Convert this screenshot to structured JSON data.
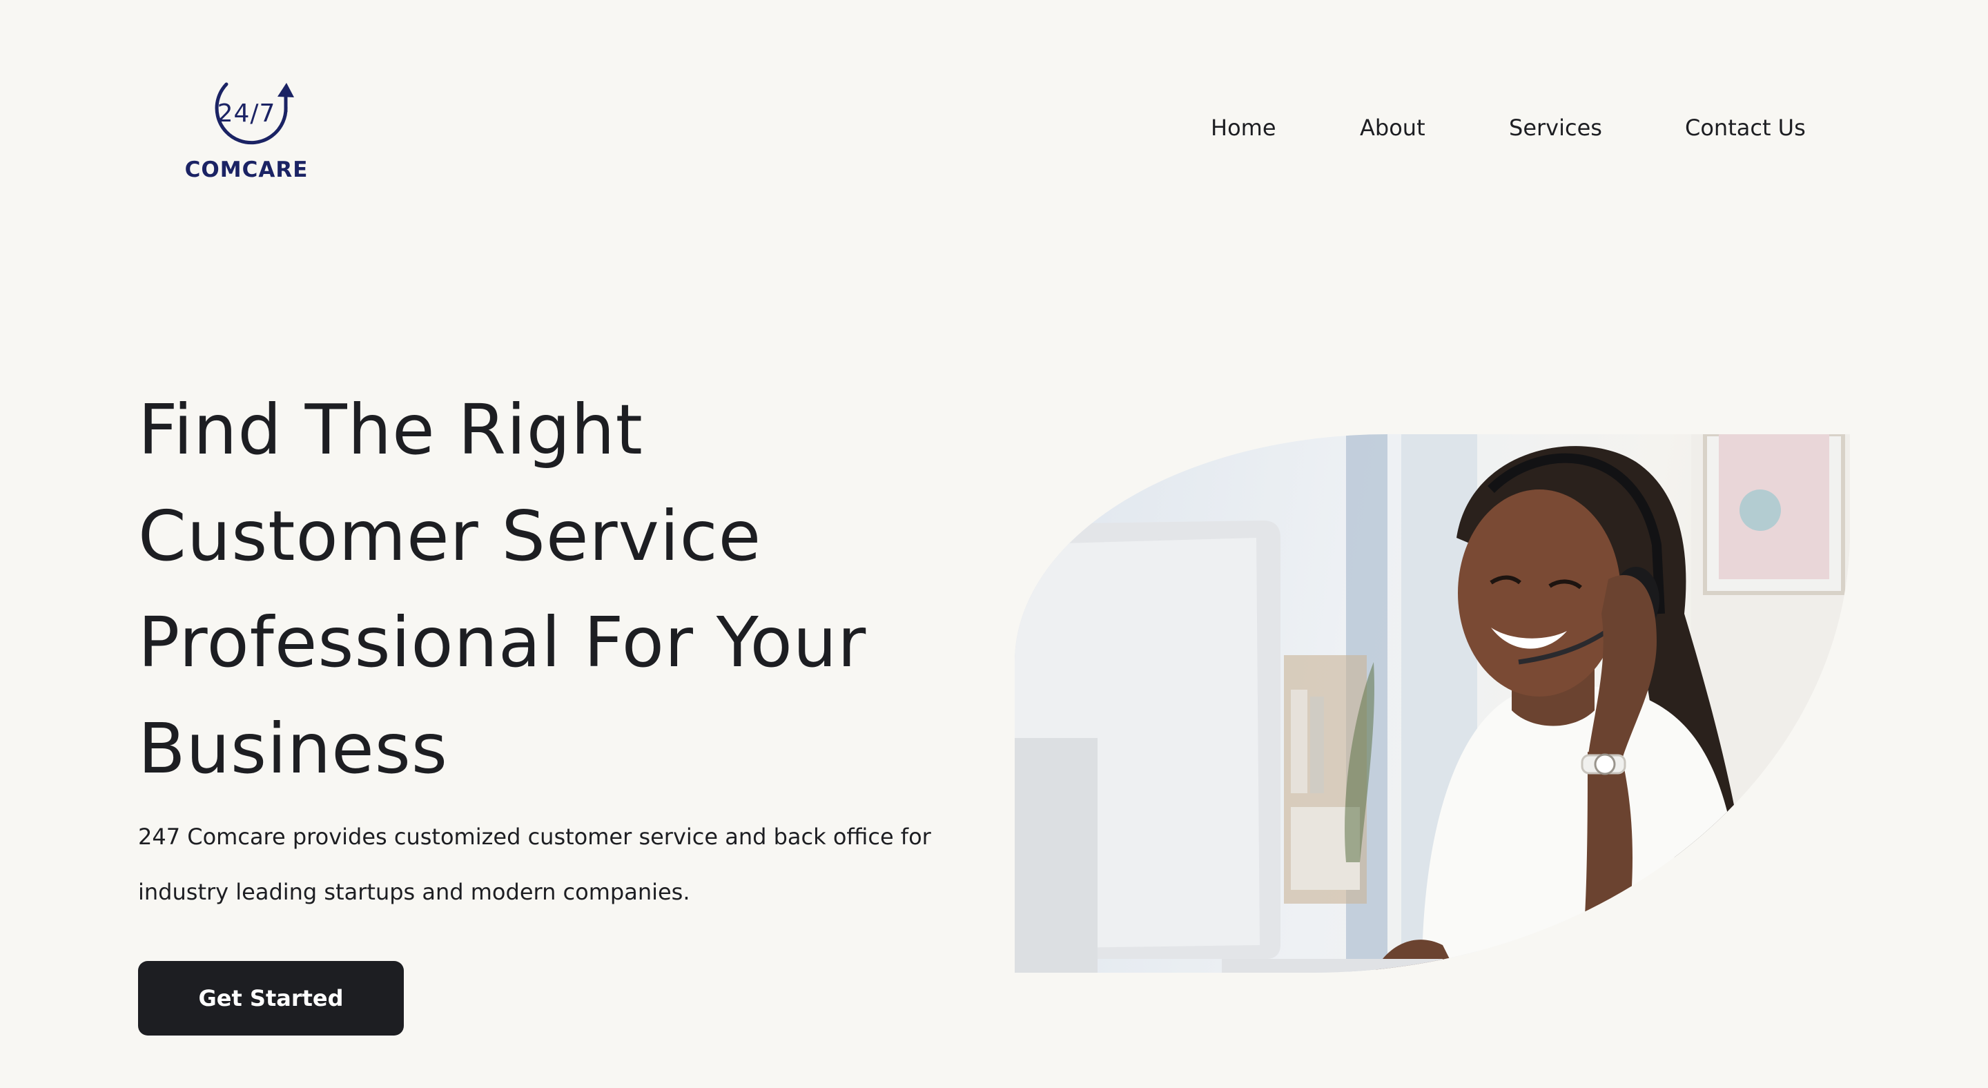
{
  "logo": {
    "numbers": "24/7",
    "wordmark": "COMCARE",
    "icon": "circular-arrow-icon",
    "color": "#1b2364"
  },
  "nav": {
    "items": [
      {
        "label": "Home"
      },
      {
        "label": "About"
      },
      {
        "label": "Services"
      },
      {
        "label": "Contact Us"
      }
    ]
  },
  "hero": {
    "title_lines": [
      "Find The Right",
      "Customer Service",
      "Professional For Your",
      "Business"
    ],
    "description_lines": [
      "247 Comcare provides customized customer service and back office for",
      "industry leading startups and modern companies."
    ],
    "cta_label": "Get Started",
    "image": "customer-service-agent-photo"
  },
  "colors": {
    "background": "#f8f7f3",
    "text": "#1d1e22",
    "button": "#1d1e22",
    "brand": "#1b2364"
  }
}
